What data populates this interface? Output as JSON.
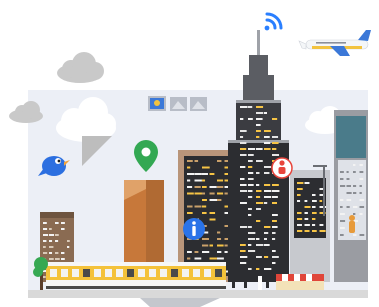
{
  "colors": {
    "background": "#ffffff",
    "backdrop_panel": "#eceff6",
    "cloud_dark": "#c9c9c9",
    "cloud_light": "#ffffff",
    "speech_tail": "#bdbdbd",
    "tower_dark": "#2c2d31",
    "tower_mid": "#5b5d63",
    "tower_light": "#9fa2a8",
    "window_yellow": "#f6c445",
    "window_white": "#f3f3f3",
    "amber_building": "#c7783a",
    "amber_light": "#e0a269",
    "tan_building": "#b9957a",
    "brown_left": "#8a6b52",
    "grey_right": "#9a9ca2",
    "teal_building": "#4a7b8a",
    "train_yellow": "#f4c23a",
    "train_white": "#f6f6f6",
    "track": "#4a4a4a",
    "tree_green": "#36a852",
    "pin_green": "#33a853",
    "bird_blue": "#2c6fe0",
    "bird_beak": "#f2a23a",
    "info_blue": "#2a73e8",
    "person_red": "#e8453c",
    "wifi_blue": "#2a7fff",
    "plane_white": "#f4f6f8",
    "plane_yellow": "#f2c33f",
    "plane_blue": "#3b78d8",
    "photo_frame": "#b8bdc7",
    "photo_sky": "#3b78d8",
    "photo_sun": "#f2c33f",
    "person_orange": "#e79a3a",
    "awning_red": "#e0463a",
    "ground": "#d9d9d9"
  },
  "icons": [
    "wifi-icon",
    "airplane-icon",
    "bird-icon",
    "map-pin-icon",
    "info-icon",
    "person-marker-icon",
    "photo-thumbnails-icon",
    "tree-icon"
  ]
}
